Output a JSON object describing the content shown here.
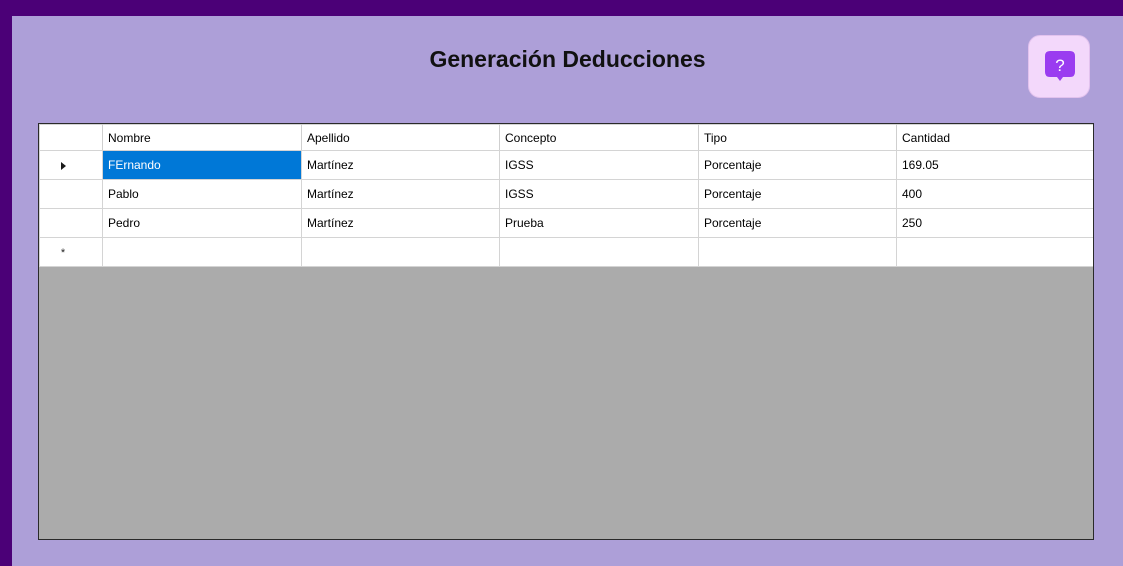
{
  "form": {
    "title": "Generación Deducciones",
    "help_icon": "question-mark-speech-bubble-icon",
    "accent_color": "#9a3cf0"
  },
  "grid": {
    "columns": [
      "Nombre",
      "Apellido",
      "Concepto",
      "Tipo",
      "Cantidad"
    ],
    "rows": [
      {
        "nombre": "FErnando",
        "apellido": "Martínez",
        "concepto": "IGSS",
        "tipo": "Porcentaje",
        "cantidad": "169.05"
      },
      {
        "nombre": "Pablo",
        "apellido": "Martínez",
        "concepto": "IGSS",
        "tipo": "Porcentaje",
        "cantidad": "400"
      },
      {
        "nombre": "Pedro",
        "apellido": "Martínez",
        "concepto": "Prueba",
        "tipo": "Porcentaje",
        "cantidad": "250"
      }
    ],
    "new_row_marker": "*",
    "current_row_icon": "triangle-right-icon"
  }
}
